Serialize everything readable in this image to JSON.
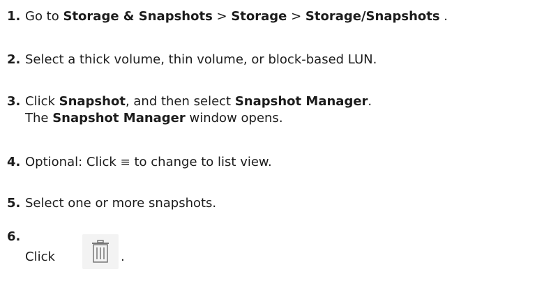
{
  "steps": [
    {
      "num": "1.",
      "parts": [
        "Go to ",
        "Storage & Snapshots",
        " > ",
        "Storage",
        " > ",
        "Storage/Snapshots",
        " ."
      ]
    },
    {
      "num": "2.",
      "text": "Select a thick volume, thin volume, or block-based LUN."
    },
    {
      "num": "3.",
      "parts": [
        "Click ",
        "Snapshot",
        ", and then select ",
        "Snapshot Manager",
        "."
      ],
      "line2_parts": [
        "The ",
        "Snapshot Manager",
        " window opens."
      ]
    },
    {
      "num": "4.",
      "before": "Optional: Click ",
      "icon": "list-view-icon",
      "icon_glyph": "≡",
      "after": " to change to list view."
    },
    {
      "num": "5.",
      "text": "Select one or more snapshots."
    },
    {
      "num": "6.",
      "click": "Click",
      "icon": "trash-icon",
      "period": "."
    }
  ]
}
